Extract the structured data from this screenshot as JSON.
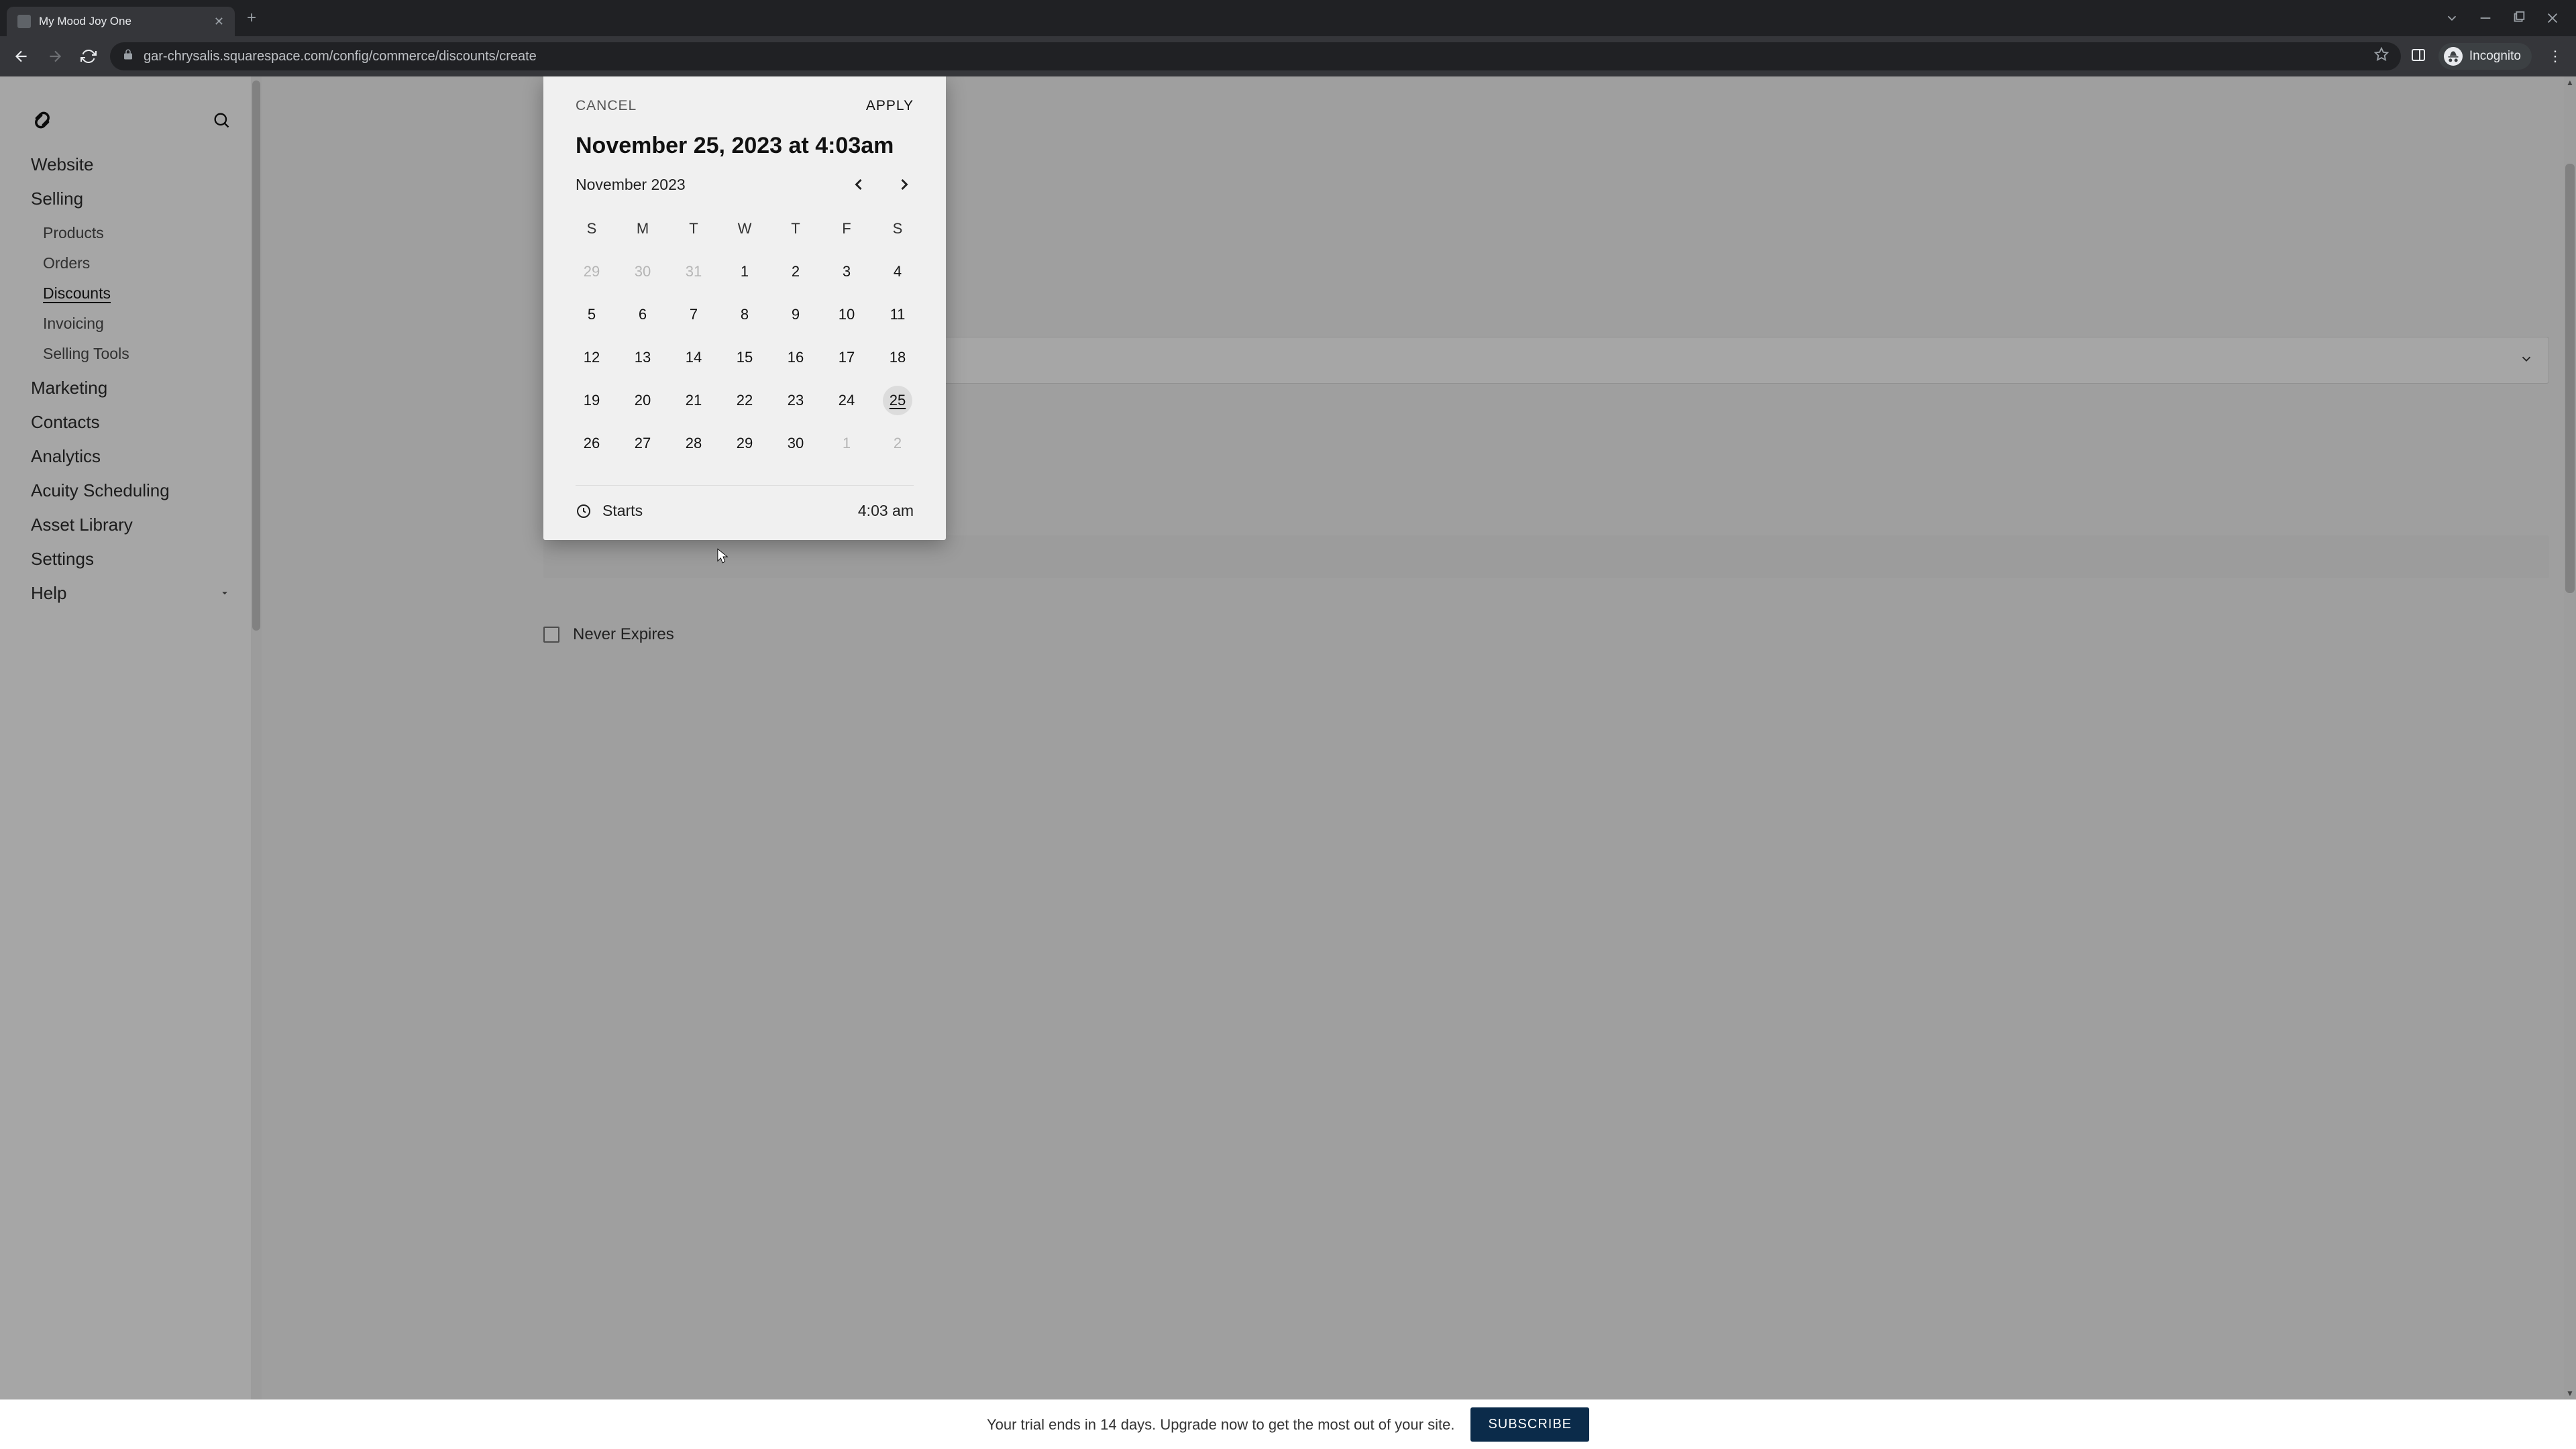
{
  "browser": {
    "tab_title": "My Mood Joy One",
    "url": "gar-chrysalis.squarespace.com/config/commerce/discounts/create",
    "incognito_label": "Incognito"
  },
  "sidebar": {
    "items": [
      {
        "label": "Website"
      },
      {
        "label": "Selling"
      },
      {
        "label": "Marketing"
      },
      {
        "label": "Contacts"
      },
      {
        "label": "Analytics"
      },
      {
        "label": "Acuity Scheduling"
      },
      {
        "label": "Asset Library"
      },
      {
        "label": "Settings"
      },
      {
        "label": "Help"
      }
    ],
    "selling_sub": [
      {
        "label": "Products"
      },
      {
        "label": "Orders"
      },
      {
        "label": "Discounts"
      },
      {
        "label": "Invoicing"
      },
      {
        "label": "Selling Tools"
      }
    ]
  },
  "trial": {
    "text": "Your trial ends in 14 days. Upgrade now to get the most out of your site.",
    "button": "SUBSCRIBE"
  },
  "never_expires_label": "Never Expires",
  "datepicker": {
    "cancel": "CANCEL",
    "apply": "APPLY",
    "headline": "November 25, 2023 at 4:03am",
    "month_label": "November 2023",
    "dow": [
      "S",
      "M",
      "T",
      "W",
      "T",
      "F",
      "S"
    ],
    "weeks": [
      [
        {
          "d": "29",
          "mute": true
        },
        {
          "d": "30",
          "mute": true
        },
        {
          "d": "31",
          "mute": true
        },
        {
          "d": "1"
        },
        {
          "d": "2"
        },
        {
          "d": "3"
        },
        {
          "d": "4"
        }
      ],
      [
        {
          "d": "5"
        },
        {
          "d": "6"
        },
        {
          "d": "7"
        },
        {
          "d": "8"
        },
        {
          "d": "9"
        },
        {
          "d": "10"
        },
        {
          "d": "11"
        }
      ],
      [
        {
          "d": "12"
        },
        {
          "d": "13"
        },
        {
          "d": "14"
        },
        {
          "d": "15"
        },
        {
          "d": "16"
        },
        {
          "d": "17"
        },
        {
          "d": "18"
        }
      ],
      [
        {
          "d": "19"
        },
        {
          "d": "20"
        },
        {
          "d": "21"
        },
        {
          "d": "22"
        },
        {
          "d": "23"
        },
        {
          "d": "24"
        },
        {
          "d": "25",
          "sel": true
        }
      ],
      [
        {
          "d": "26"
        },
        {
          "d": "27"
        },
        {
          "d": "28"
        },
        {
          "d": "29"
        },
        {
          "d": "30"
        },
        {
          "d": "1",
          "mute": true
        },
        {
          "d": "2",
          "mute": true
        }
      ]
    ],
    "starts_label": "Starts",
    "starts_time": "4:03 am"
  }
}
